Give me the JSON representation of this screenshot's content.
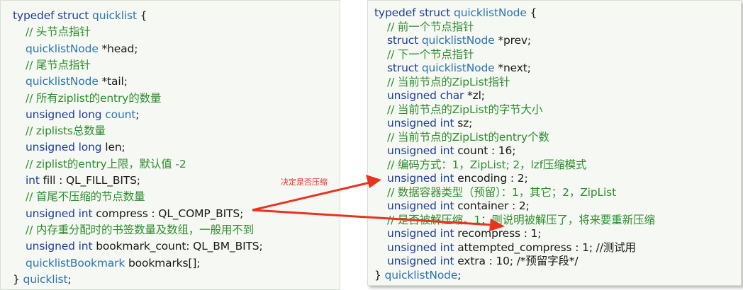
{
  "left_struct": {
    "lines": [
      [
        [
          "kw",
          "typedef struct "
        ],
        [
          "ty",
          "quicklist"
        ],
        [
          "nm",
          " {"
        ]
      ],
      [
        [
          "cm",
          "// 头节点指针"
        ]
      ],
      [
        [
          "ty",
          "quicklistNode"
        ],
        [
          "nm",
          " *head;"
        ]
      ],
      [
        [
          "cm",
          "// 尾节点指针"
        ]
      ],
      [
        [
          "ty",
          "quicklistNode"
        ],
        [
          "nm",
          " *tail;"
        ]
      ],
      [
        [
          "cm",
          "// 所有ziplist的entry的数量"
        ]
      ],
      [
        [
          "kw",
          "unsigned long "
        ],
        [
          "ty",
          "count"
        ],
        [
          "nm",
          ";"
        ]
      ],
      [
        [
          "cm",
          "// ziplists总数量"
        ]
      ],
      [
        [
          "kw",
          "unsigned long "
        ],
        [
          "nm",
          "len;"
        ]
      ],
      [
        [
          "cm",
          "// ziplist的entry上限，默认值 -2"
        ]
      ],
      [
        [
          "kw",
          "int "
        ],
        [
          "nm",
          "fill : QL_FILL_BITS;"
        ]
      ],
      [
        [
          "cm",
          "// 首尾不压缩的节点数量"
        ]
      ],
      [
        [
          "kw",
          "unsigned int "
        ],
        [
          "nm",
          "compress : QL_COMP_BITS;"
        ]
      ],
      [
        [
          "cm",
          "// 内存重分配时的书签数量及数组，一般用不到"
        ]
      ],
      [
        [
          "kw",
          "unsigned int "
        ],
        [
          "nm",
          "bookmark_count: QL_BM_BITS;"
        ]
      ],
      [
        [
          "ty",
          "quicklistBookmark "
        ],
        [
          "nm",
          "bookmarks[];"
        ]
      ],
      [
        [
          "nm",
          "} "
        ],
        [
          "ty",
          "quicklist"
        ],
        [
          "nm",
          ";"
        ]
      ]
    ]
  },
  "right_struct": {
    "lines": [
      [
        [
          "kw",
          "typedef struct "
        ],
        [
          "ty",
          "quicklistNode"
        ],
        [
          "nm",
          " {"
        ]
      ],
      [
        [
          "cm",
          "// 前一个节点指针"
        ]
      ],
      [
        [
          "kw",
          "struct "
        ],
        [
          "ty",
          "quicklistNode"
        ],
        [
          "nm",
          " *prev;"
        ]
      ],
      [
        [
          "cm",
          "// 下一个节点指针"
        ]
      ],
      [
        [
          "kw",
          "struct "
        ],
        [
          "ty",
          "quicklistNode"
        ],
        [
          "nm",
          " *next;"
        ]
      ],
      [
        [
          "cm",
          "// 当前节点的ZipList指针"
        ]
      ],
      [
        [
          "kw",
          "unsigned char "
        ],
        [
          "nm",
          "*zl;"
        ]
      ],
      [
        [
          "cm",
          "// 当前节点的ZipList的字节大小"
        ]
      ],
      [
        [
          "kw",
          "unsigned int "
        ],
        [
          "nm",
          "sz;"
        ]
      ],
      [
        [
          "cm",
          "// 当前节点的ZipList的entry个数"
        ]
      ],
      [
        [
          "kw",
          "unsigned int "
        ],
        [
          "nm",
          "count : 16;"
        ]
      ],
      [
        [
          "cm",
          "// 编码方式：1，ZipList; 2，lzf压缩模式"
        ]
      ],
      [
        [
          "kw",
          "unsigned int "
        ],
        [
          "nm",
          "encoding : 2;"
        ]
      ],
      [
        [
          "cm",
          "// 数据容器类型（预留）：1，其它；2，ZipList"
        ]
      ],
      [
        [
          "kw",
          "unsigned int "
        ],
        [
          "nm",
          "container : 2;"
        ]
      ],
      [
        [
          "cm",
          "// 是否被解压缩。1：则说明被解压了，将来要重新压缩"
        ]
      ],
      [
        [
          "kw",
          "unsigned int "
        ],
        [
          "nm",
          "recompress : 1;"
        ]
      ],
      [
        [
          "kw",
          "unsigned int "
        ],
        [
          "nm",
          "attempted_compress : 1; //测试用"
        ]
      ],
      [
        [
          "kw",
          "unsigned int "
        ],
        [
          "nm",
          "extra : 10; /*预留字段*/"
        ]
      ],
      [
        [
          "nm",
          "} "
        ],
        [
          "ty",
          "quicklistNode"
        ],
        [
          "nm",
          ";"
        ]
      ]
    ]
  },
  "annotation": {
    "label": "决定是否压缩",
    "color": "#e0332a"
  },
  "colors": {
    "keyword": "#1f3f98",
    "type": "#2b74b1",
    "comment": "#2e8d2e",
    "arrow": "#e8331f"
  }
}
